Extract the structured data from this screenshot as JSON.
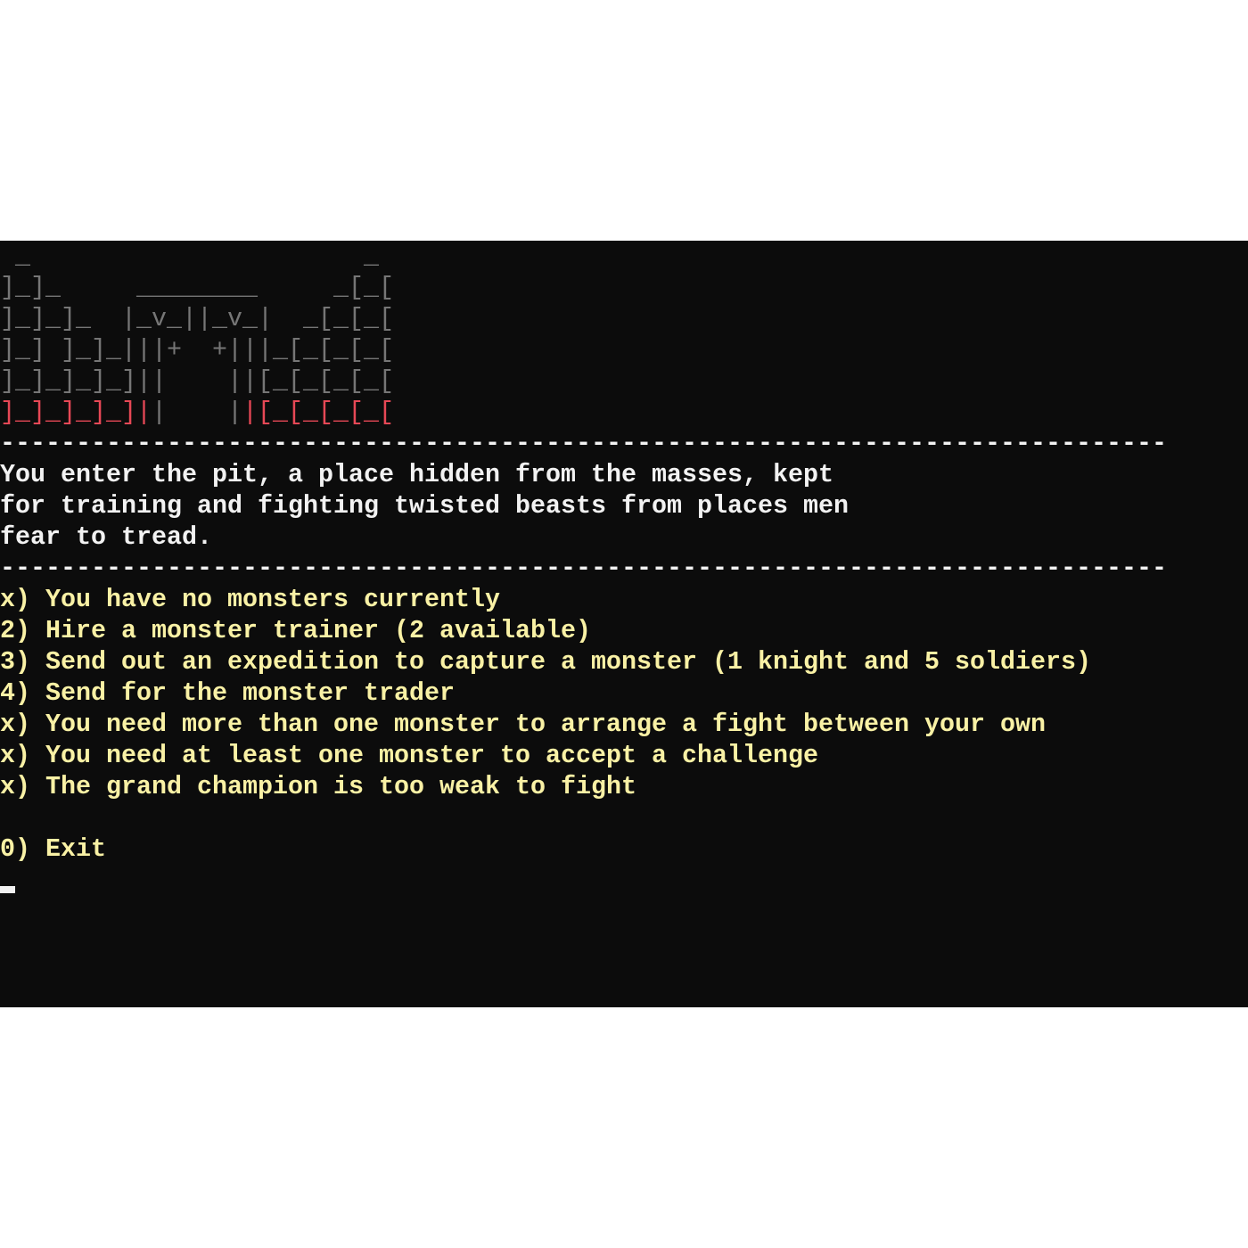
{
  "terminal": {
    "banner": [
      [
        {
          "t": " _                      _",
          "c": "gray"
        }
      ],
      [
        {
          "t": "]_]_     ________     _[_[",
          "c": "gray"
        }
      ],
      [
        {
          "t": "]_]_]_  |_v_||_v_|  _[_[_[",
          "c": "gray"
        }
      ],
      [
        {
          "t": "]_] ]_]_|||+  +|||_[_[_[_[",
          "c": "gray"
        }
      ],
      [
        {
          "t": "]_]_]_]_]||    ||[_[_[_[_[",
          "c": "gray"
        }
      ],
      [
        {
          "t": "]_]_]_]_]|",
          "c": "red"
        },
        {
          "t": "|    |",
          "c": "gray"
        },
        {
          "t": "|[_[_[_[_[",
          "c": "red"
        }
      ]
    ],
    "separator": "-----------------------------------------------------------------------------",
    "intro": [
      "You enter the pit, a place hidden from the masses, kept",
      "for training and fighting twisted beasts from places men",
      "fear to tread."
    ],
    "menu": [
      {
        "key": "x",
        "label": "You have no monsters currently",
        "enabled": false
      },
      {
        "key": "2",
        "label": "Hire a monster trainer (2 available)",
        "enabled": true
      },
      {
        "key": "3",
        "label": "Send out an expedition to capture a monster (1 knight and 5 soldiers)",
        "enabled": true
      },
      {
        "key": "4",
        "label": "Send for the monster trader",
        "enabled": true
      },
      {
        "key": "x",
        "label": "You need more than one monster to arrange a fight between your own",
        "enabled": false
      },
      {
        "key": "x",
        "label": "You need at least one monster to accept a challenge",
        "enabled": false
      },
      {
        "key": "x",
        "label": "The grand champion is too weak to fight",
        "enabled": false
      }
    ],
    "exit": {
      "key": "0",
      "label": "Exit"
    },
    "colors": {
      "background": "#0c0c0c",
      "banner_gray": "#767676",
      "banner_red": "#e74856",
      "intro_text": "#f2f2f2",
      "menu_text": "#f9f1a5"
    }
  }
}
